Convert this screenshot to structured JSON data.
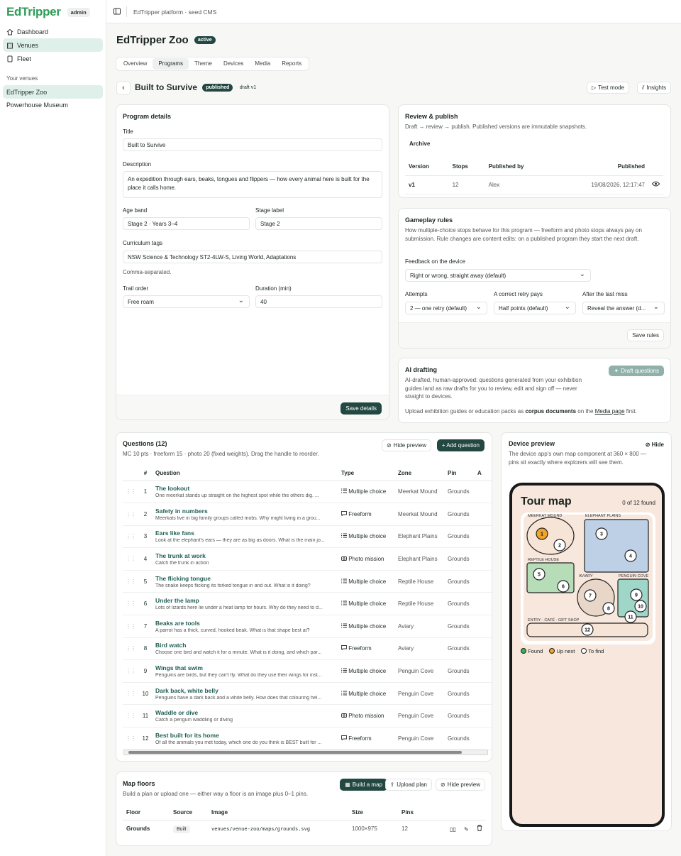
{
  "app": {
    "logo": "EdTripper",
    "role": "admin",
    "breadcrumb": "EdTripper platform · seed CMS"
  },
  "sidebar": {
    "nav": [
      {
        "label": "Dashboard",
        "icon": "home-icon"
      },
      {
        "label": "Venues",
        "icon": "building-icon"
      },
      {
        "label": "Fleet",
        "icon": "tablet-icon"
      }
    ],
    "section_label": "Your venues",
    "venues": [
      "EdTripper Zoo",
      "Powerhouse Museum"
    ]
  },
  "venue": {
    "name": "EdTripper Zoo",
    "status": "active",
    "tabs": [
      "Overview",
      "Programs",
      "Theme",
      "Devices",
      "Media",
      "Reports"
    ],
    "active_tab": "Programs"
  },
  "program": {
    "title": "Built to Survive",
    "status": "published",
    "draft": "draft v1",
    "actions": {
      "test_mode": "Test mode",
      "insights": "Insights"
    }
  },
  "details": {
    "heading": "Program details",
    "title_label": "Title",
    "title_value": "Built to Survive",
    "description_label": "Description",
    "description_value": "An expedition through ears, beaks, tongues and flippers — how every animal here is built for the place it calls home.",
    "age_label": "Age band",
    "age_value": "Stage 2 · Years 3–4",
    "stage_label": "Stage label",
    "stage_value": "Stage 2",
    "tags_label": "Curriculum tags",
    "tags_value": "NSW Science & Technology ST2-4LW-S, Living World, Adaptations",
    "tags_hint": "Comma-separated.",
    "trail_label": "Trail order",
    "trail_value": "Free roam",
    "duration_label": "Duration (min)",
    "duration_value": "40",
    "save": "Save details"
  },
  "review": {
    "heading": "Review & publish",
    "desc": "Draft → review → publish. Published versions are immutable snapshots.",
    "archive": "Archive",
    "columns": [
      "Version",
      "Stops",
      "Published by",
      "Published"
    ],
    "rows": [
      {
        "version": "v1",
        "stops": "12",
        "by": "Alex",
        "published": "19/08/2026, 12:17:47"
      }
    ]
  },
  "gameplay": {
    "heading": "Gameplay rules",
    "desc": "How multiple-choice stops behave for this program — freeform and photo stops always pay on submission. Rule changes are content edits: on a published program they start the next draft.",
    "feedback_label": "Feedback on the device",
    "feedback_value": "Right or wrong, straight away (default)",
    "attempts_label": "Attempts",
    "attempts_value": "2 — one retry (default)",
    "retry_label": "A correct retry pays",
    "retry_value": "Half points (default)",
    "miss_label": "After the last miss",
    "miss_value": "Reveal the answer (d...",
    "save": "Save rules"
  },
  "ai": {
    "heading": "AI drafting",
    "button": "Draft questions",
    "desc": "AI-drafted, human-approved: questions generated from your exhibition guides land as raw drafts for you to review, edit and sign off — never straight to devices.",
    "upload_pre": "Upload exhibition guides or education packs as ",
    "upload_bold": "corpus documents",
    "upload_mid": " on the ",
    "upload_link": "Media page",
    "upload_post": " first."
  },
  "questions": {
    "heading": "Questions (12)",
    "subtitle": "MC 10 pts · freeform 15 · photo 20 (fixed weights). Drag the handle to reorder.",
    "hide_preview": "Hide preview",
    "add": "+ Add question",
    "columns": [
      "#",
      "Question",
      "Type",
      "Zone",
      "Pin",
      "A"
    ],
    "rows": [
      {
        "n": "1",
        "title": "The lookout",
        "sub": "One meerkat stands up straight on the highest spot while the others dig. ...",
        "type": "Multiple choice",
        "icon": "list-icon",
        "zone": "Meerkat Mound",
        "pin": "Grounds"
      },
      {
        "n": "2",
        "title": "Safety in numbers",
        "sub": "Meerkats live in big family groups called mobs. Why might living in a grou...",
        "type": "Freeform",
        "icon": "chat-icon",
        "zone": "Meerkat Mound",
        "pin": "Grounds"
      },
      {
        "n": "3",
        "title": "Ears like fans",
        "sub": "Look at the elephant's ears — they are as big as doors. What is the main jo...",
        "type": "Multiple choice",
        "icon": "list-icon",
        "zone": "Elephant Plains",
        "pin": "Grounds"
      },
      {
        "n": "4",
        "title": "The trunk at work",
        "sub": "Catch the trunk in action",
        "type": "Photo mission",
        "icon": "camera-icon",
        "zone": "Elephant Plains",
        "pin": "Grounds"
      },
      {
        "n": "5",
        "title": "The flicking tongue",
        "sub": "The snake keeps flicking its forked tongue in and out. What is it doing?",
        "type": "Multiple choice",
        "icon": "list-icon",
        "zone": "Reptile House",
        "pin": "Grounds"
      },
      {
        "n": "6",
        "title": "Under the lamp",
        "sub": "Lots of lizards here lie under a heat lamp for hours. Why do they need to d...",
        "type": "Multiple choice",
        "icon": "list-icon",
        "zone": "Reptile House",
        "pin": "Grounds"
      },
      {
        "n": "7",
        "title": "Beaks are tools",
        "sub": "A parrot has a thick, curved, hooked beak. What is that shape best at?",
        "type": "Multiple choice",
        "icon": "list-icon",
        "zone": "Aviary",
        "pin": "Grounds"
      },
      {
        "n": "8",
        "title": "Bird watch",
        "sub": "Choose one bird and watch it for a minute. What is it doing, and which par...",
        "type": "Freeform",
        "icon": "chat-icon",
        "zone": "Aviary",
        "pin": "Grounds"
      },
      {
        "n": "9",
        "title": "Wings that swim",
        "sub": "Penguins are birds, but they can't fly. What do they use their wings for inst...",
        "type": "Multiple choice",
        "icon": "list-icon",
        "zone": "Penguin Cove",
        "pin": "Grounds"
      },
      {
        "n": "10",
        "title": "Dark back, white belly",
        "sub": "Penguins have a dark back and a white belly. How does that colouring hel...",
        "type": "Multiple choice",
        "icon": "list-icon",
        "zone": "Penguin Cove",
        "pin": "Grounds"
      },
      {
        "n": "11",
        "title": "Waddle or dive",
        "sub": "Catch a penguin waddling or diving",
        "type": "Photo mission",
        "icon": "camera-icon",
        "zone": "Penguin Cove",
        "pin": "Grounds"
      },
      {
        "n": "12",
        "title": "Best built for its home",
        "sub": "Of all the animals you met today, which one do you think is BEST built for ...",
        "type": "Freeform",
        "icon": "chat-icon",
        "zone": "Penguin Cove",
        "pin": "Grounds"
      }
    ]
  },
  "preview": {
    "heading": "Device preview",
    "hide": "Hide",
    "desc": "The device app's own map component at 360 × 800 — pins sit exactly where explorers will see them.",
    "map_title": "Tour map",
    "found": "0 of 12 found",
    "zones": [
      "MEERKAT MOUND",
      "ELEPHANT PLAINS",
      "REPTILE HOUSE",
      "AVIARY",
      "PENGUIN COVE",
      "ENTRY · CAFÉ · GIFT SHOP"
    ],
    "pins": [
      "1",
      "2",
      "3",
      "4",
      "5",
      "6",
      "7",
      "8",
      "9",
      "10",
      "11",
      "12"
    ],
    "legend": [
      "Found",
      "Up next",
      "To find"
    ],
    "colors": {
      "found": "#36b25a",
      "up_next": "#f0a429",
      "to_find": "#ffffff"
    }
  },
  "floors": {
    "heading": "Map floors",
    "desc": "Build a plan or upload one — either way a floor is an image plus 0–1 pins.",
    "build": "Build a map",
    "upload": "Upload plan",
    "hide_preview": "Hide preview",
    "columns": [
      "Floor",
      "Source",
      "Image",
      "Size",
      "Pins"
    ],
    "rows": [
      {
        "floor": "Grounds",
        "source": "Built",
        "image": "venues/venue-zoo/maps/grounds.svg",
        "size": "1000×975",
        "pins": "12"
      }
    ]
  }
}
